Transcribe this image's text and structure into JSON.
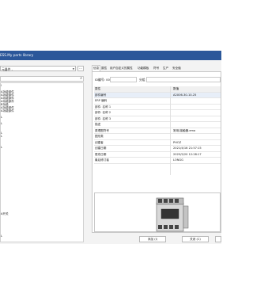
{
  "window": {
    "title": "ESS.My parts library"
  },
  "left": {
    "combo_value": "元器件 -",
    "combo_button": "...",
    "tree_items": [
      "l",
      "A功能部件",
      "A功能部件",
      "A功能部件",
      "A功能部件",
      "B功能",
      "A功能部件",
      "A功能部件",
      "L",
      "L",
      "L",
      "L",
      "L",
      "A开关",
      "L"
    ]
  },
  "tabs": [
    "信息",
    "属性",
    "用户自定义的属性",
    "功能模板",
    "符号",
    "生产",
    "安全值"
  ],
  "header": {
    "id_label": "ID编号: 00",
    "group_label": "分组"
  },
  "grid": {
    "col1": "属性",
    "col2": "数值",
    "rows": [
      {
        "name": "部件编号",
        "value": "A2X06-30-10-25"
      },
      {
        "name": "ERP 编码",
        "value": ""
      },
      {
        "name": "部件: 名称 1",
        "value": ""
      },
      {
        "name": "部件: 名称 2",
        "value": ""
      },
      {
        "name": "部件: 名称 3",
        "value": ""
      },
      {
        "name": "描述",
        "value": ""
      },
      {
        "name": "原理图符号",
        "value": "常用\\接触器.ema"
      },
      {
        "name": "图形类",
        "value": ""
      },
      {
        "name": "创建者",
        "value": "PHOZ"
      },
      {
        "name": "创建日期",
        "value": "2021/4/16 21:57:15"
      },
      {
        "name": "更改日期",
        "value": "2025/5/20 12:28:17"
      },
      {
        "name": "最后修订者",
        "value": "LONGG"
      }
    ]
  },
  "buttons": {
    "add": "添加 (I)",
    "close": "关闭 (C)"
  },
  "colors": {
    "title_bar": "#2b579a"
  }
}
